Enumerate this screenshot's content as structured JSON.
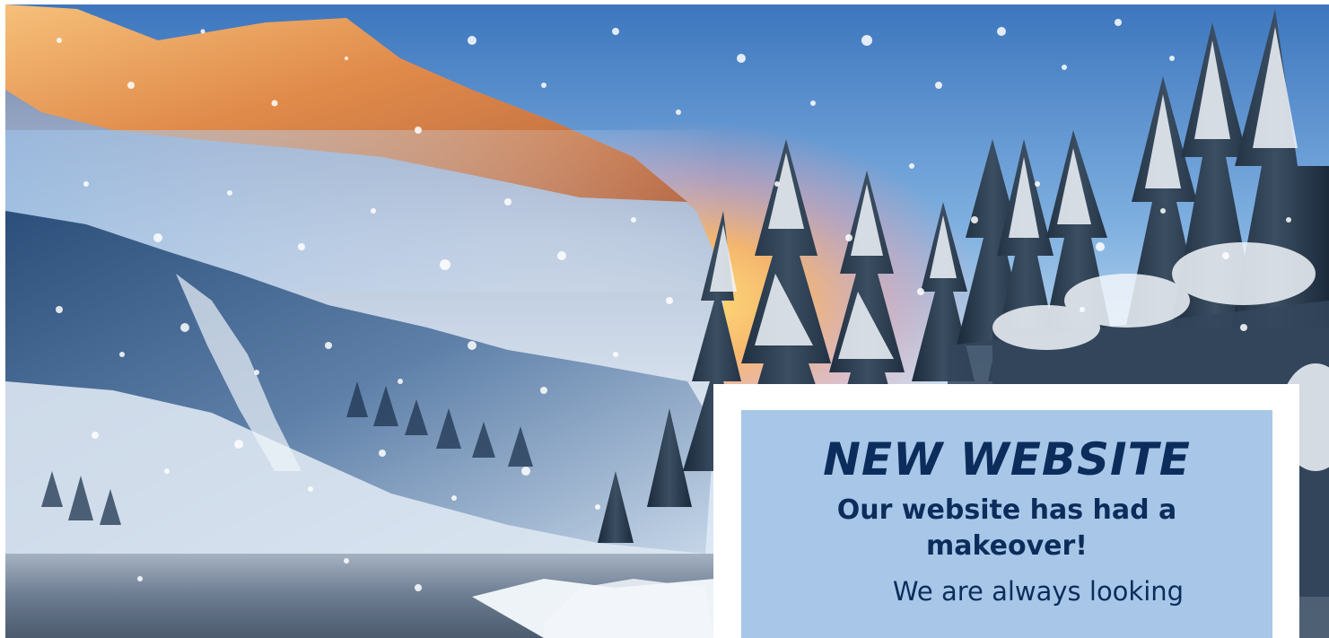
{
  "announcement": {
    "title": "NEW WEBSITE",
    "subtitle": "Our website has had a makeover!",
    "body": "We are always looking"
  },
  "colors": {
    "text_navy": "#0c2d5c",
    "panel_blue": "#a8c7e8",
    "card_white": "#ffffff"
  }
}
